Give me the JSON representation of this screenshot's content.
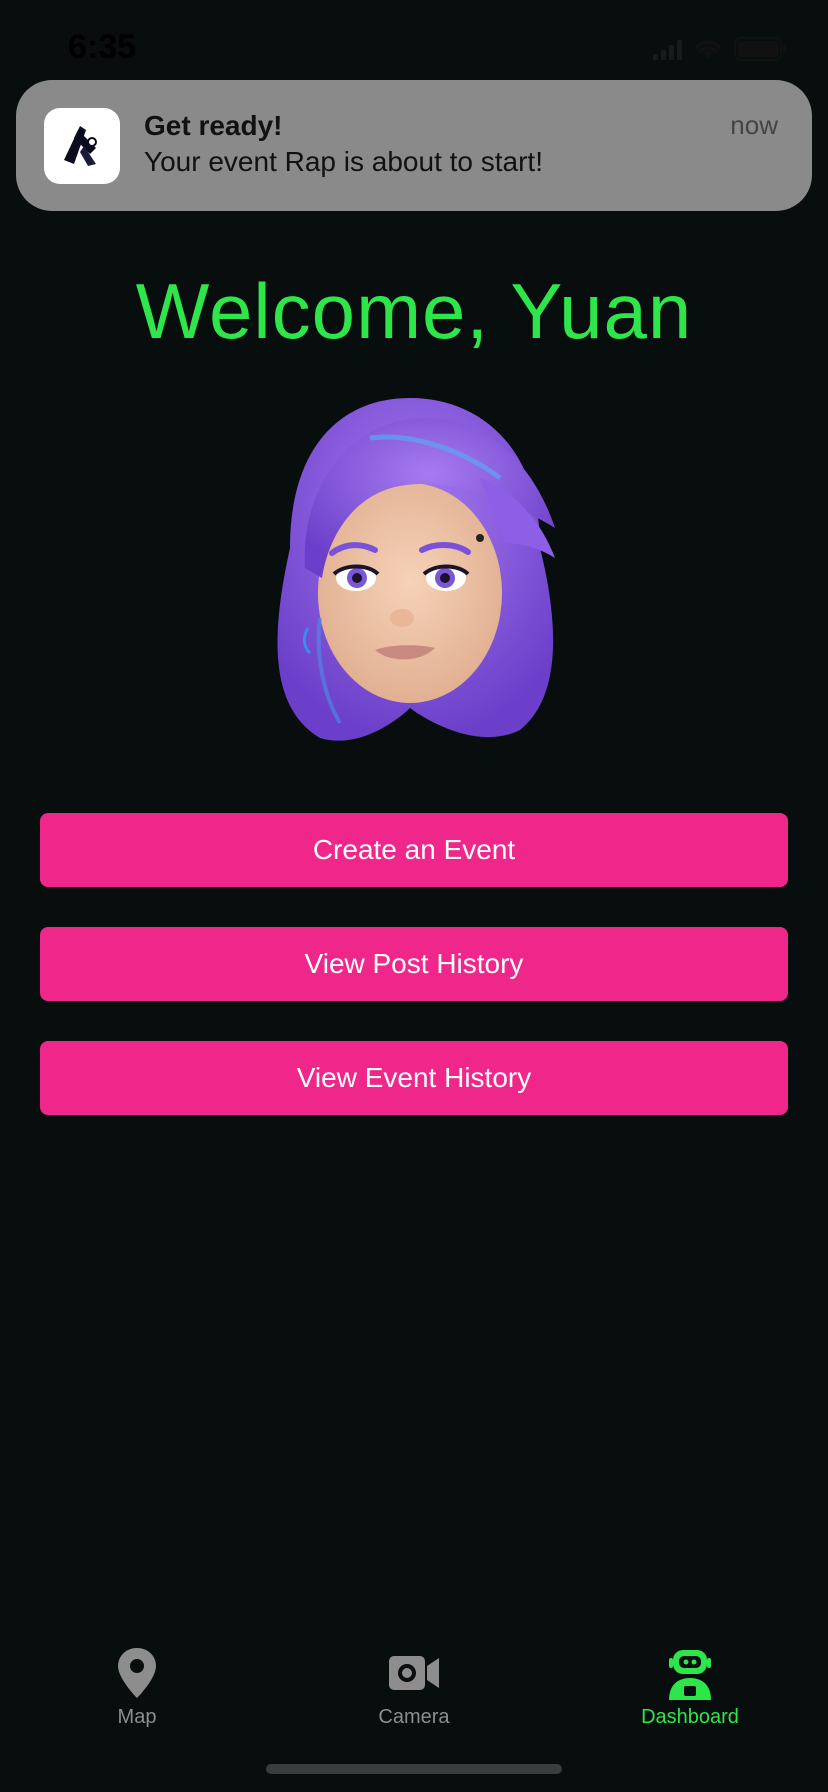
{
  "status_bar": {
    "time": "6:35"
  },
  "notification": {
    "title": "Get ready!",
    "body": "Your event Rap is about to start!",
    "time": "now",
    "app_icon": "app-logo-icon"
  },
  "welcome": {
    "text": "Welcome, Yuan"
  },
  "avatar": {
    "icon": "memoji-avatar-purple-hair"
  },
  "actions": {
    "create_event": "Create an Event",
    "view_post_history": "View Post History",
    "view_event_history": "View Event History"
  },
  "tab_bar": {
    "tabs": [
      {
        "label": "Map",
        "icon": "map-pin-icon",
        "active": false
      },
      {
        "label": "Camera",
        "icon": "video-camera-icon",
        "active": false
      },
      {
        "label": "Dashboard",
        "icon": "robot-user-icon",
        "active": true
      }
    ]
  },
  "colors": {
    "background": "#080d0d",
    "accent_green": "#2fe64a",
    "button_pink": "#f0278a",
    "tab_inactive": "#8d8d8d"
  }
}
